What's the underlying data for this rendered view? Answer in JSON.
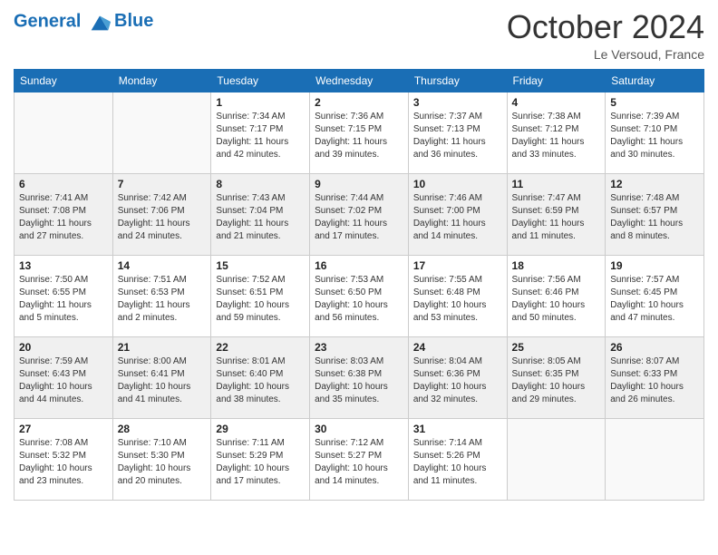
{
  "header": {
    "logo_line1": "General",
    "logo_line2": "Blue",
    "month": "October 2024",
    "location": "Le Versoud, France"
  },
  "days_of_week": [
    "Sunday",
    "Monday",
    "Tuesday",
    "Wednesday",
    "Thursday",
    "Friday",
    "Saturday"
  ],
  "weeks": [
    [
      {
        "day": "",
        "sunrise": "",
        "sunset": "",
        "daylight": ""
      },
      {
        "day": "",
        "sunrise": "",
        "sunset": "",
        "daylight": ""
      },
      {
        "day": "1",
        "sunrise": "Sunrise: 7:34 AM",
        "sunset": "Sunset: 7:17 PM",
        "daylight": "Daylight: 11 hours and 42 minutes."
      },
      {
        "day": "2",
        "sunrise": "Sunrise: 7:36 AM",
        "sunset": "Sunset: 7:15 PM",
        "daylight": "Daylight: 11 hours and 39 minutes."
      },
      {
        "day": "3",
        "sunrise": "Sunrise: 7:37 AM",
        "sunset": "Sunset: 7:13 PM",
        "daylight": "Daylight: 11 hours and 36 minutes."
      },
      {
        "day": "4",
        "sunrise": "Sunrise: 7:38 AM",
        "sunset": "Sunset: 7:12 PM",
        "daylight": "Daylight: 11 hours and 33 minutes."
      },
      {
        "day": "5",
        "sunrise": "Sunrise: 7:39 AM",
        "sunset": "Sunset: 7:10 PM",
        "daylight": "Daylight: 11 hours and 30 minutes."
      }
    ],
    [
      {
        "day": "6",
        "sunrise": "Sunrise: 7:41 AM",
        "sunset": "Sunset: 7:08 PM",
        "daylight": "Daylight: 11 hours and 27 minutes."
      },
      {
        "day": "7",
        "sunrise": "Sunrise: 7:42 AM",
        "sunset": "Sunset: 7:06 PM",
        "daylight": "Daylight: 11 hours and 24 minutes."
      },
      {
        "day": "8",
        "sunrise": "Sunrise: 7:43 AM",
        "sunset": "Sunset: 7:04 PM",
        "daylight": "Daylight: 11 hours and 21 minutes."
      },
      {
        "day": "9",
        "sunrise": "Sunrise: 7:44 AM",
        "sunset": "Sunset: 7:02 PM",
        "daylight": "Daylight: 11 hours and 17 minutes."
      },
      {
        "day": "10",
        "sunrise": "Sunrise: 7:46 AM",
        "sunset": "Sunset: 7:00 PM",
        "daylight": "Daylight: 11 hours and 14 minutes."
      },
      {
        "day": "11",
        "sunrise": "Sunrise: 7:47 AM",
        "sunset": "Sunset: 6:59 PM",
        "daylight": "Daylight: 11 hours and 11 minutes."
      },
      {
        "day": "12",
        "sunrise": "Sunrise: 7:48 AM",
        "sunset": "Sunset: 6:57 PM",
        "daylight": "Daylight: 11 hours and 8 minutes."
      }
    ],
    [
      {
        "day": "13",
        "sunrise": "Sunrise: 7:50 AM",
        "sunset": "Sunset: 6:55 PM",
        "daylight": "Daylight: 11 hours and 5 minutes."
      },
      {
        "day": "14",
        "sunrise": "Sunrise: 7:51 AM",
        "sunset": "Sunset: 6:53 PM",
        "daylight": "Daylight: 11 hours and 2 minutes."
      },
      {
        "day": "15",
        "sunrise": "Sunrise: 7:52 AM",
        "sunset": "Sunset: 6:51 PM",
        "daylight": "Daylight: 10 hours and 59 minutes."
      },
      {
        "day": "16",
        "sunrise": "Sunrise: 7:53 AM",
        "sunset": "Sunset: 6:50 PM",
        "daylight": "Daylight: 10 hours and 56 minutes."
      },
      {
        "day": "17",
        "sunrise": "Sunrise: 7:55 AM",
        "sunset": "Sunset: 6:48 PM",
        "daylight": "Daylight: 10 hours and 53 minutes."
      },
      {
        "day": "18",
        "sunrise": "Sunrise: 7:56 AM",
        "sunset": "Sunset: 6:46 PM",
        "daylight": "Daylight: 10 hours and 50 minutes."
      },
      {
        "day": "19",
        "sunrise": "Sunrise: 7:57 AM",
        "sunset": "Sunset: 6:45 PM",
        "daylight": "Daylight: 10 hours and 47 minutes."
      }
    ],
    [
      {
        "day": "20",
        "sunrise": "Sunrise: 7:59 AM",
        "sunset": "Sunset: 6:43 PM",
        "daylight": "Daylight: 10 hours and 44 minutes."
      },
      {
        "day": "21",
        "sunrise": "Sunrise: 8:00 AM",
        "sunset": "Sunset: 6:41 PM",
        "daylight": "Daylight: 10 hours and 41 minutes."
      },
      {
        "day": "22",
        "sunrise": "Sunrise: 8:01 AM",
        "sunset": "Sunset: 6:40 PM",
        "daylight": "Daylight: 10 hours and 38 minutes."
      },
      {
        "day": "23",
        "sunrise": "Sunrise: 8:03 AM",
        "sunset": "Sunset: 6:38 PM",
        "daylight": "Daylight: 10 hours and 35 minutes."
      },
      {
        "day": "24",
        "sunrise": "Sunrise: 8:04 AM",
        "sunset": "Sunset: 6:36 PM",
        "daylight": "Daylight: 10 hours and 32 minutes."
      },
      {
        "day": "25",
        "sunrise": "Sunrise: 8:05 AM",
        "sunset": "Sunset: 6:35 PM",
        "daylight": "Daylight: 10 hours and 29 minutes."
      },
      {
        "day": "26",
        "sunrise": "Sunrise: 8:07 AM",
        "sunset": "Sunset: 6:33 PM",
        "daylight": "Daylight: 10 hours and 26 minutes."
      }
    ],
    [
      {
        "day": "27",
        "sunrise": "Sunrise: 7:08 AM",
        "sunset": "Sunset: 5:32 PM",
        "daylight": "Daylight: 10 hours and 23 minutes."
      },
      {
        "day": "28",
        "sunrise": "Sunrise: 7:10 AM",
        "sunset": "Sunset: 5:30 PM",
        "daylight": "Daylight: 10 hours and 20 minutes."
      },
      {
        "day": "29",
        "sunrise": "Sunrise: 7:11 AM",
        "sunset": "Sunset: 5:29 PM",
        "daylight": "Daylight: 10 hours and 17 minutes."
      },
      {
        "day": "30",
        "sunrise": "Sunrise: 7:12 AM",
        "sunset": "Sunset: 5:27 PM",
        "daylight": "Daylight: 10 hours and 14 minutes."
      },
      {
        "day": "31",
        "sunrise": "Sunrise: 7:14 AM",
        "sunset": "Sunset: 5:26 PM",
        "daylight": "Daylight: 10 hours and 11 minutes."
      },
      {
        "day": "",
        "sunrise": "",
        "sunset": "",
        "daylight": ""
      },
      {
        "day": "",
        "sunrise": "",
        "sunset": "",
        "daylight": ""
      }
    ]
  ]
}
